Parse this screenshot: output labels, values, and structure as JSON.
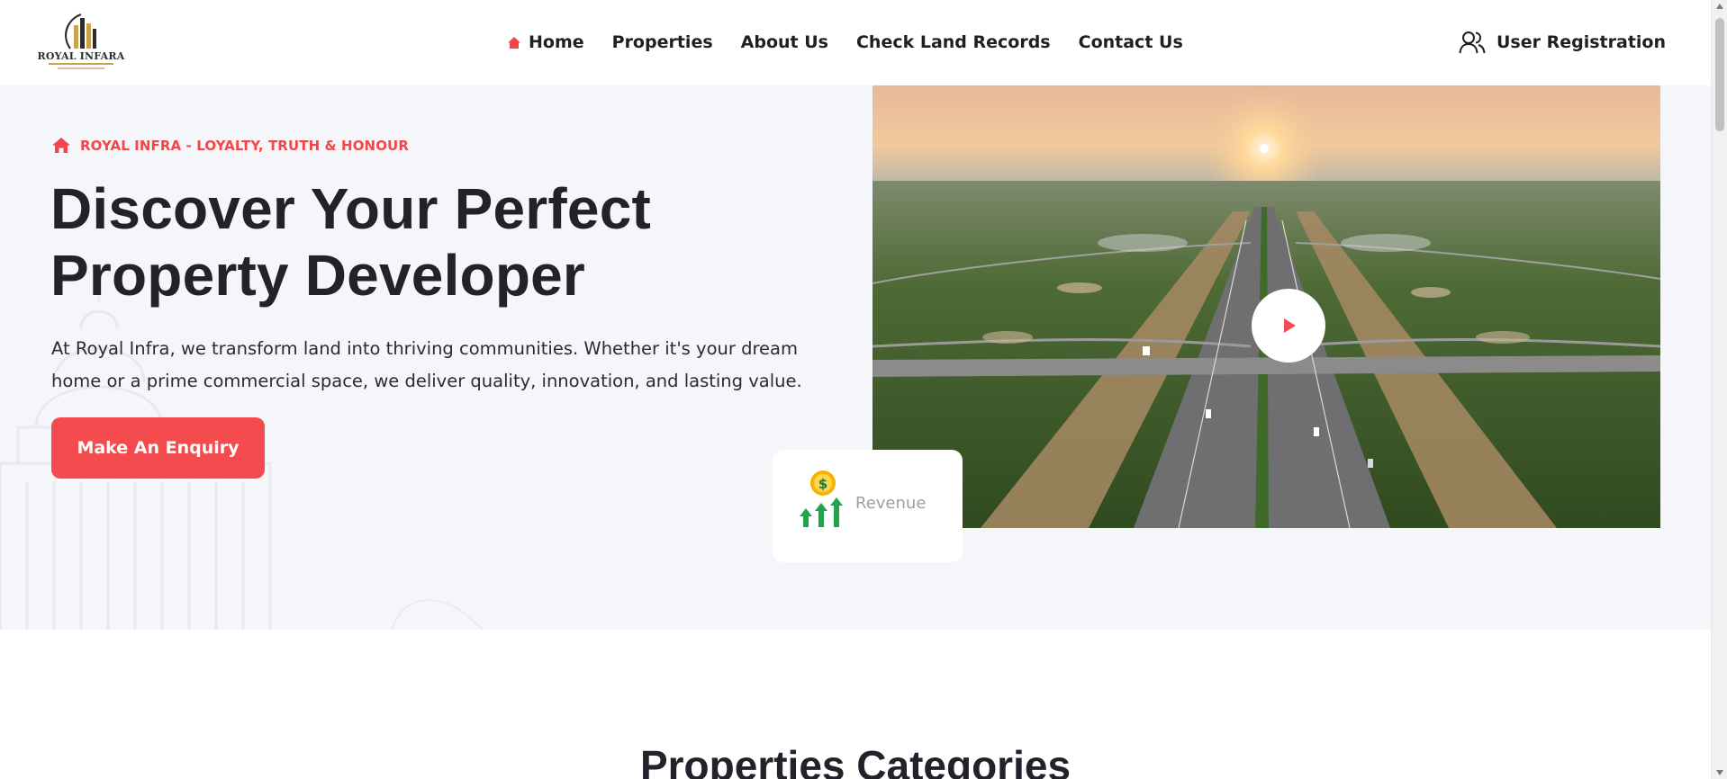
{
  "header": {
    "logo_text": "ROYAL INFARA",
    "nav": [
      {
        "label": "Home",
        "icon": "home-icon"
      },
      {
        "label": "Properties"
      },
      {
        "label": "About Us"
      },
      {
        "label": "Check Land Records"
      },
      {
        "label": "Contact Us"
      }
    ],
    "user_registration": {
      "label": "User Registration",
      "icon": "user-group-icon"
    }
  },
  "hero": {
    "eyebrow": "ROYAL INFRA - LOYALTY, TRUTH & HONOUR",
    "title_line1": "Discover Your Perfect",
    "title_line2": "Property Developer",
    "description_line1": "At Royal Infra, we transform land into thriving communities. Whether it's your dream",
    "description_line2": "home or a prime commercial space, we deliver quality, innovation, and lasting value.",
    "cta_label": "Make An Enquiry",
    "media_alt": "aerial-highway-sunset-image",
    "play_icon": "play-icon",
    "revenue_label": "Revenue"
  },
  "categories": {
    "title": "Properties Categories"
  },
  "colors": {
    "accent": "#f34b4e",
    "text_dark": "#22222a",
    "hero_bg": "#f5f6f9",
    "revenue_green": "#1fa64a",
    "coin_gold": "#f4b400"
  }
}
